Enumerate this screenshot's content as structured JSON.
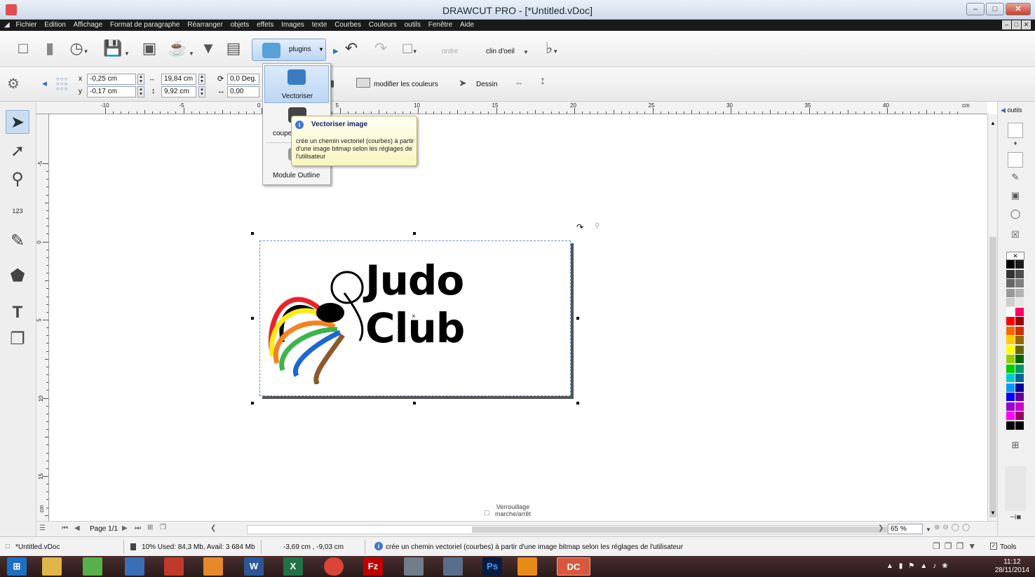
{
  "window": {
    "title": "DRAWCUT PRO - [*Untitled.vDoc]",
    "minimize": "–",
    "maximize": "□",
    "close": "✕"
  },
  "menu": [
    "Fichier",
    "Edition",
    "Affichage",
    "Format de paragraphe",
    "Réarranger",
    "objets",
    "effets",
    "Images",
    "texte",
    "Courbes",
    "Couleurs",
    "outils",
    "Fenêtre",
    "Aide"
  ],
  "mdi": {
    "minimize": "–",
    "restore": "□",
    "close": "✕"
  },
  "toolbar1": {
    "plugins_label": "plugins",
    "ordre_label": "ordre",
    "clin_doeil_label": "clin d'oeil"
  },
  "toolbar2": {
    "x_label": "x",
    "x_value": "-0,25 cm",
    "y_label": "y",
    "y_value": "-0,17 cm",
    "width_value": "19,84 cm",
    "height_value": "9,92 cm",
    "rotation_value": "0,0 Deg.",
    "spacing_value": "0,00",
    "modifier_couleurs_label": "modifier les couleurs",
    "dessin_label": "Dessin"
  },
  "plugins_menu": {
    "vectoriser_label": "Vectoriser",
    "coupe_label": "coupe",
    "module_outline_label": "Module Outline"
  },
  "tooltip": {
    "title": "Vectoriser image",
    "body": "crée un chemin vectoriel (courbes)  à partir d'une image bitmap selon les réglages de l'utilisateur"
  },
  "ruler": {
    "top_labels": [
      "-10",
      "-5",
      "0",
      "5",
      "10",
      "15",
      "20",
      "25",
      "30",
      "35",
      "40"
    ],
    "unit": "cm",
    "left_labels": [
      "-5",
      "0",
      "5",
      "10",
      "15"
    ],
    "left_unit": "cm"
  },
  "canvas": {
    "logo_text": "Judo Club",
    "center_mark": "×",
    "lock_label_line1": "Verrouillage",
    "lock_label_line2": "marche/arrêt"
  },
  "right_panel": {
    "outils_label": "outils",
    "palette": [
      "#000000",
      "#1a1a1a",
      "#333333",
      "#4d4d4d",
      "#666666",
      "#808080",
      "#999999",
      "#b3b3b3",
      "#cccccc",
      "#e6e6e6",
      "#ffffff",
      "#ff0066",
      "#ff0000",
      "#990000",
      "#ff6600",
      "#cc3300",
      "#ffcc00",
      "#996600",
      "#ffff00",
      "#666600",
      "#99cc00",
      "#006600",
      "#00cc00",
      "#009966",
      "#00cccc",
      "#006699",
      "#0099ff",
      "#000099",
      "#0000ff",
      "#660099",
      "#9900cc",
      "#cc00cc",
      "#ff00ff",
      "#990066",
      "#000000",
      "#000000"
    ]
  },
  "bottom_nav": {
    "page_label": "Page 1/1",
    "zoom_value": "65 %"
  },
  "status": {
    "doc_name": "*Untitled.vDoc",
    "memory": "10%  Used: 84,3 Mb, Avail: 3 684 Mb",
    "coords": "-3,69 cm , -9,03 cm",
    "message": "crée un chemin vectoriel (courbes)  à partir d'une image bitmap selon les réglages de l'utilisateur",
    "tools_label": "Tools"
  },
  "taskbar": {
    "apps": [
      "W",
      "X",
      "Fz",
      "Ps",
      "DC"
    ],
    "time": "11:12",
    "date": "28/11/2014"
  }
}
